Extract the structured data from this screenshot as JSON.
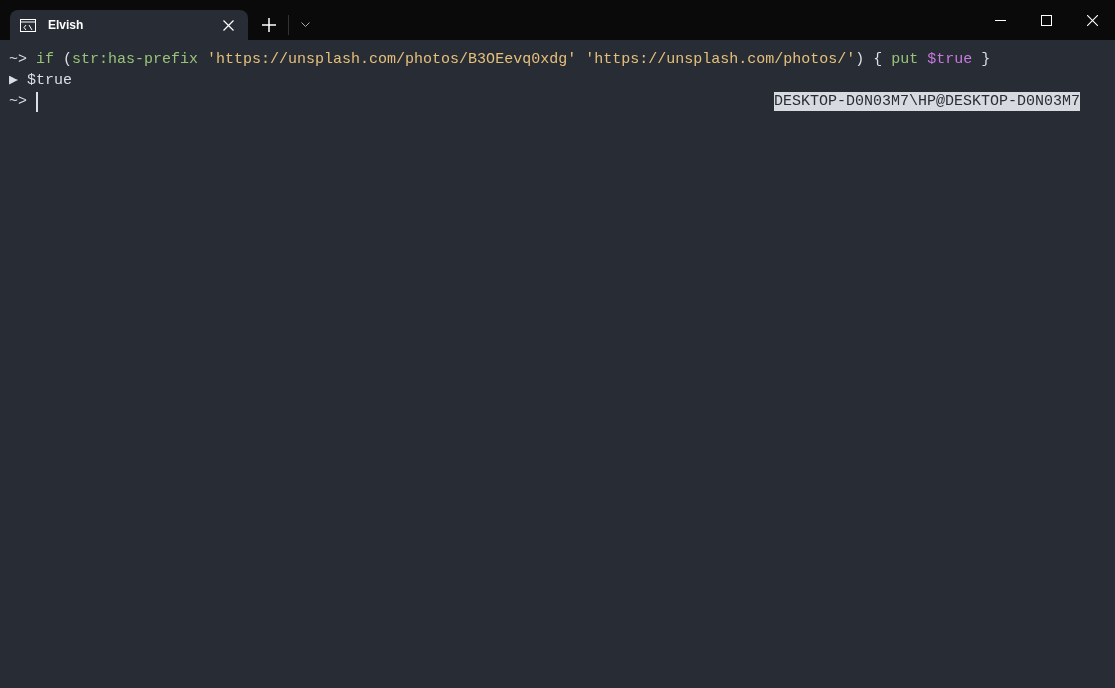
{
  "tab": {
    "title": "Elvish",
    "selected": true
  },
  "lines": [
    {
      "prompt": "~>",
      "tokens": [
        {
          "kind": "keyword",
          "text": "if"
        },
        {
          "kind": "plain",
          "text": "("
        },
        {
          "kind": "command",
          "text": "str:has-prefix",
          "glued": true
        },
        {
          "kind": "string",
          "text": "'https://unsplash.com/photos/B3OEevq0xdg'"
        },
        {
          "kind": "string",
          "text": "'https://unsplash.com/photos/'"
        },
        {
          "kind": "plain",
          "text": ")",
          "glued": true
        },
        {
          "kind": "plain",
          "text": "{"
        },
        {
          "kind": "command",
          "text": "put"
        },
        {
          "kind": "variable",
          "text": "$true"
        },
        {
          "kind": "plain",
          "text": "}"
        }
      ]
    },
    {
      "prompt": "▶",
      "tokens": [
        {
          "kind": "plain",
          "text": "$true"
        }
      ]
    },
    {
      "prompt": "~>",
      "cursor": true,
      "right_prompt": "DESKTOP-D0N03M7\\HP@DESKTOP-D0N03M7"
    }
  ]
}
